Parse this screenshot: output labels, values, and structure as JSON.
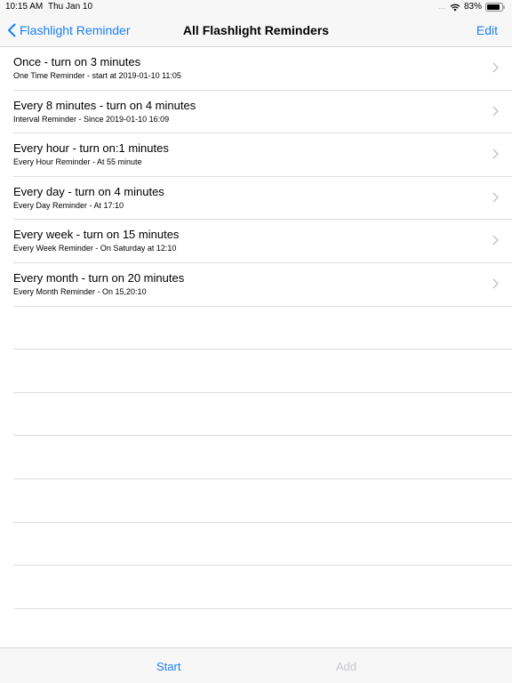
{
  "status_bar": {
    "time": "10:15 AM",
    "date": "Thu Jan 10",
    "signal": "....",
    "battery": "83%",
    "wifi_icon": "wifi-icon",
    "battery_icon": "battery-icon"
  },
  "nav": {
    "back_label": "Flashlight Reminder",
    "back_icon": "chevron-left-icon",
    "title": "All Flashlight Reminders",
    "edit_label": "Edit"
  },
  "reminders": [
    {
      "title": "Once - turn on 3 minutes",
      "subtitle": "One Time Reminder - start at 2019-01-10 11:05"
    },
    {
      "title": "Every 8 minutes - turn on 4 minutes",
      "subtitle": "Interval Reminder - Since 2019-01-10 16:09"
    },
    {
      "title": "Every hour - turn on:1 minutes",
      "subtitle": "Every Hour Reminder - At 55 minute"
    },
    {
      "title": "Every day - turn on 4 minutes",
      "subtitle": "Every Day Reminder - At 17:10"
    },
    {
      "title": "Every week - turn on 15 minutes",
      "subtitle": "Every Week Reminder - On Saturday at 12:10"
    },
    {
      "title": "Every month - turn on 20 minutes",
      "subtitle": "Every Month Reminder - On 15,20:10"
    }
  ],
  "toolbar": {
    "start_label": "Start",
    "add_label": "Add"
  },
  "colors": {
    "accent": "#1a7ff5",
    "disabled": "#c7c7cc",
    "separator": "#dcdcdf",
    "bar_background": "#f7f7f7"
  }
}
